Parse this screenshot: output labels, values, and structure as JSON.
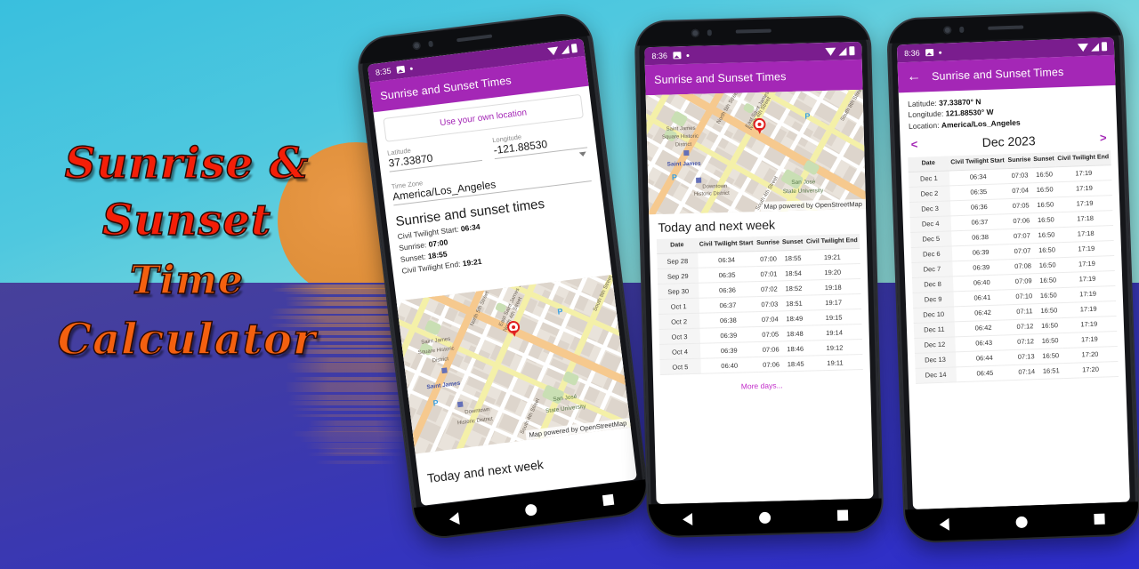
{
  "poster": {
    "title_lines": [
      "Sunrise &",
      "Sunset",
      "Time",
      "Calculator"
    ],
    "colors": {
      "title_red": "#F41F08",
      "title_orange": "#F4600F",
      "sun": "#E0913B",
      "sky": "#4FC8DF",
      "sea": "#3434BE",
      "accent_purple": "#A427B6",
      "statusbar_purple": "#7A1D8E"
    }
  },
  "phone1": {
    "status": {
      "time": "8:35",
      "image_icon": "image-icon",
      "dot_icon": "dot-icon",
      "wifi_icon": "wifi-icon",
      "signal_icon": "signal-icon",
      "battery_icon": "battery-icon"
    },
    "appbar": {
      "title": "Sunrise and Sunset Times"
    },
    "location_button": "Use your own location",
    "latitude": {
      "label": "Latitude",
      "value": "37.33870"
    },
    "longitude": {
      "label": "Longitude",
      "value": "-121.88530"
    },
    "timezone": {
      "label": "Time Zone",
      "value": "America/Los_Angeles"
    },
    "results": {
      "heading": "Sunrise and sunset times",
      "civil_twilight_start_label": "Civil Twilight Start:",
      "civil_twilight_start": "06:34",
      "sunrise_label": "Sunrise:",
      "sunrise": "07:00",
      "sunset_label": "Sunset:",
      "sunset": "18:55",
      "civil_twilight_end_label": "Civil Twilight End:",
      "civil_twilight_end": "19:21"
    },
    "map_attribution": "Map powered by OpenStreetMap",
    "footer_heading": "Today and next week",
    "nav": {
      "back": "back-icon",
      "home": "home-icon",
      "recents": "recents-icon"
    }
  },
  "phone2": {
    "status": {
      "time": "8:36"
    },
    "appbar": {
      "title": "Sunrise and Sunset Times"
    },
    "map_attribution": "Map powered by OpenStreetMap",
    "section_heading": "Today and next week",
    "table": {
      "headers": [
        "Date",
        "Civil Twilight Start",
        "Sunrise",
        "Sunset",
        "Civil Twilight End"
      ],
      "rows": [
        [
          "Sep 28",
          "06:34",
          "07:00",
          "18:55",
          "19:21"
        ],
        [
          "Sep 29",
          "06:35",
          "07:01",
          "18:54",
          "19:20"
        ],
        [
          "Sep 30",
          "06:36",
          "07:02",
          "18:52",
          "19:18"
        ],
        [
          "Oct 1",
          "06:37",
          "07:03",
          "18:51",
          "19:17"
        ],
        [
          "Oct 2",
          "06:38",
          "07:04",
          "18:49",
          "19:15"
        ],
        [
          "Oct 3",
          "06:39",
          "07:05",
          "18:48",
          "19:14"
        ],
        [
          "Oct 4",
          "06:39",
          "07:06",
          "18:46",
          "19:12"
        ],
        [
          "Oct 5",
          "06:40",
          "07:06",
          "18:45",
          "19:11"
        ]
      ]
    },
    "more_days": "More days..."
  },
  "phone3": {
    "status": {
      "time": "8:36"
    },
    "appbar": {
      "title": "Sunrise and Sunset Times",
      "back": "back-arrow-icon"
    },
    "meta": {
      "latitude_label": "Latitude:",
      "latitude": "37.33870° N",
      "longitude_label": "Longitude:",
      "longitude": "121.88530° W",
      "location_label": "Location:",
      "location": "America/Los_Angeles"
    },
    "month": {
      "prev": "<",
      "name": "Dec 2023",
      "next": ">"
    },
    "table": {
      "headers": [
        "Date",
        "Civil Twilight Start",
        "Sunrise",
        "Sunset",
        "Civil Twilight End"
      ],
      "rows": [
        [
          "Dec 1",
          "06:34",
          "07:03",
          "16:50",
          "17:19"
        ],
        [
          "Dec 2",
          "06:35",
          "07:04",
          "16:50",
          "17:19"
        ],
        [
          "Dec 3",
          "06:36",
          "07:05",
          "16:50",
          "17:19"
        ],
        [
          "Dec 4",
          "06:37",
          "07:06",
          "16:50",
          "17:18"
        ],
        [
          "Dec 5",
          "06:38",
          "07:07",
          "16:50",
          "17:18"
        ],
        [
          "Dec 6",
          "06:39",
          "07:07",
          "16:50",
          "17:19"
        ],
        [
          "Dec 7",
          "06:39",
          "07:08",
          "16:50",
          "17:19"
        ],
        [
          "Dec 8",
          "06:40",
          "07:09",
          "16:50",
          "17:19"
        ],
        [
          "Dec 9",
          "06:41",
          "07:10",
          "16:50",
          "17:19"
        ],
        [
          "Dec 10",
          "06:42",
          "07:11",
          "16:50",
          "17:19"
        ],
        [
          "Dec 11",
          "06:42",
          "07:12",
          "16:50",
          "17:19"
        ],
        [
          "Dec 12",
          "06:43",
          "07:12",
          "16:50",
          "17:19"
        ],
        [
          "Dec 13",
          "06:44",
          "07:13",
          "16:50",
          "17:20"
        ],
        [
          "Dec 14",
          "06:45",
          "07:14",
          "16:51",
          "17:20"
        ]
      ]
    }
  },
  "map": {
    "labels": [
      "Saint James Square Historic District",
      "Saint James",
      "Downtown Historic District",
      "San José State University",
      "North 5th Street",
      "East Saint James Street",
      "North 4th Street",
      "South 8th Street",
      "South 4th Street"
    ],
    "parking_icon": "parking-icon",
    "marker_icon": "map-pin-icon"
  }
}
